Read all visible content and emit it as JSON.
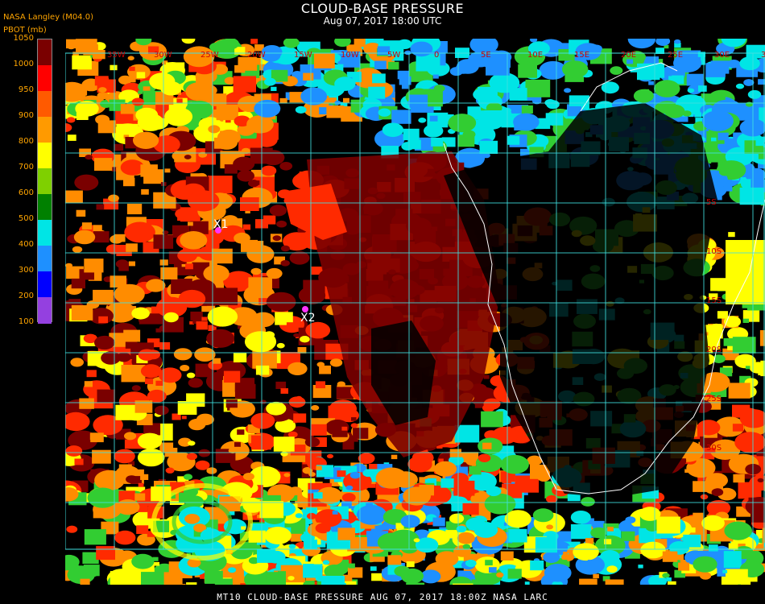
{
  "header": {
    "title": "CLOUD-BASE PRESSURE",
    "subtitle": "Aug 07, 2017 18:00 UTC",
    "source": "NASA Langley (M04.0)",
    "unit": "PBOT (mb)"
  },
  "legend": {
    "ticks": [
      "1050",
      "1000",
      "950",
      "900",
      "800",
      "700",
      "600",
      "500",
      "400",
      "300",
      "200",
      "100"
    ],
    "colors": [
      "#7a0000",
      "#ff0000",
      "#ff5a00",
      "#ff9a00",
      "#ffff00",
      "#7fd000",
      "#008000",
      "#00e5e5",
      "#1e90ff",
      "#0000ff",
      "#9440e0"
    ]
  },
  "map": {
    "colors": {
      "dark_red": "#7a0000",
      "red": "#ff2a00",
      "orange": "#ff8c00",
      "yellow": "#ffff00",
      "green": "#32cd32",
      "cyan": "#00e5e5",
      "blue": "#1e90ff",
      "gridline": "#40e0e0",
      "coast": "#ffffff",
      "marker": "#ff33ff"
    },
    "grid_labels_top": [
      "35W",
      "30W",
      "25W",
      "20W",
      "15W",
      "10W",
      "5W",
      "0",
      "5E",
      "10E",
      "15E",
      "20E",
      "25E",
      "30E",
      "35E"
    ],
    "grid_labels_right": [
      "5S",
      "10S",
      "15S",
      "20S",
      "25S",
      "30S"
    ],
    "markers": [
      {
        "label": "X1"
      },
      {
        "label": "X2"
      }
    ]
  },
  "footer": "MT10  CLOUD-BASE PRESSURE  AUG 07, 2017 18:00Z  NASA LARC"
}
